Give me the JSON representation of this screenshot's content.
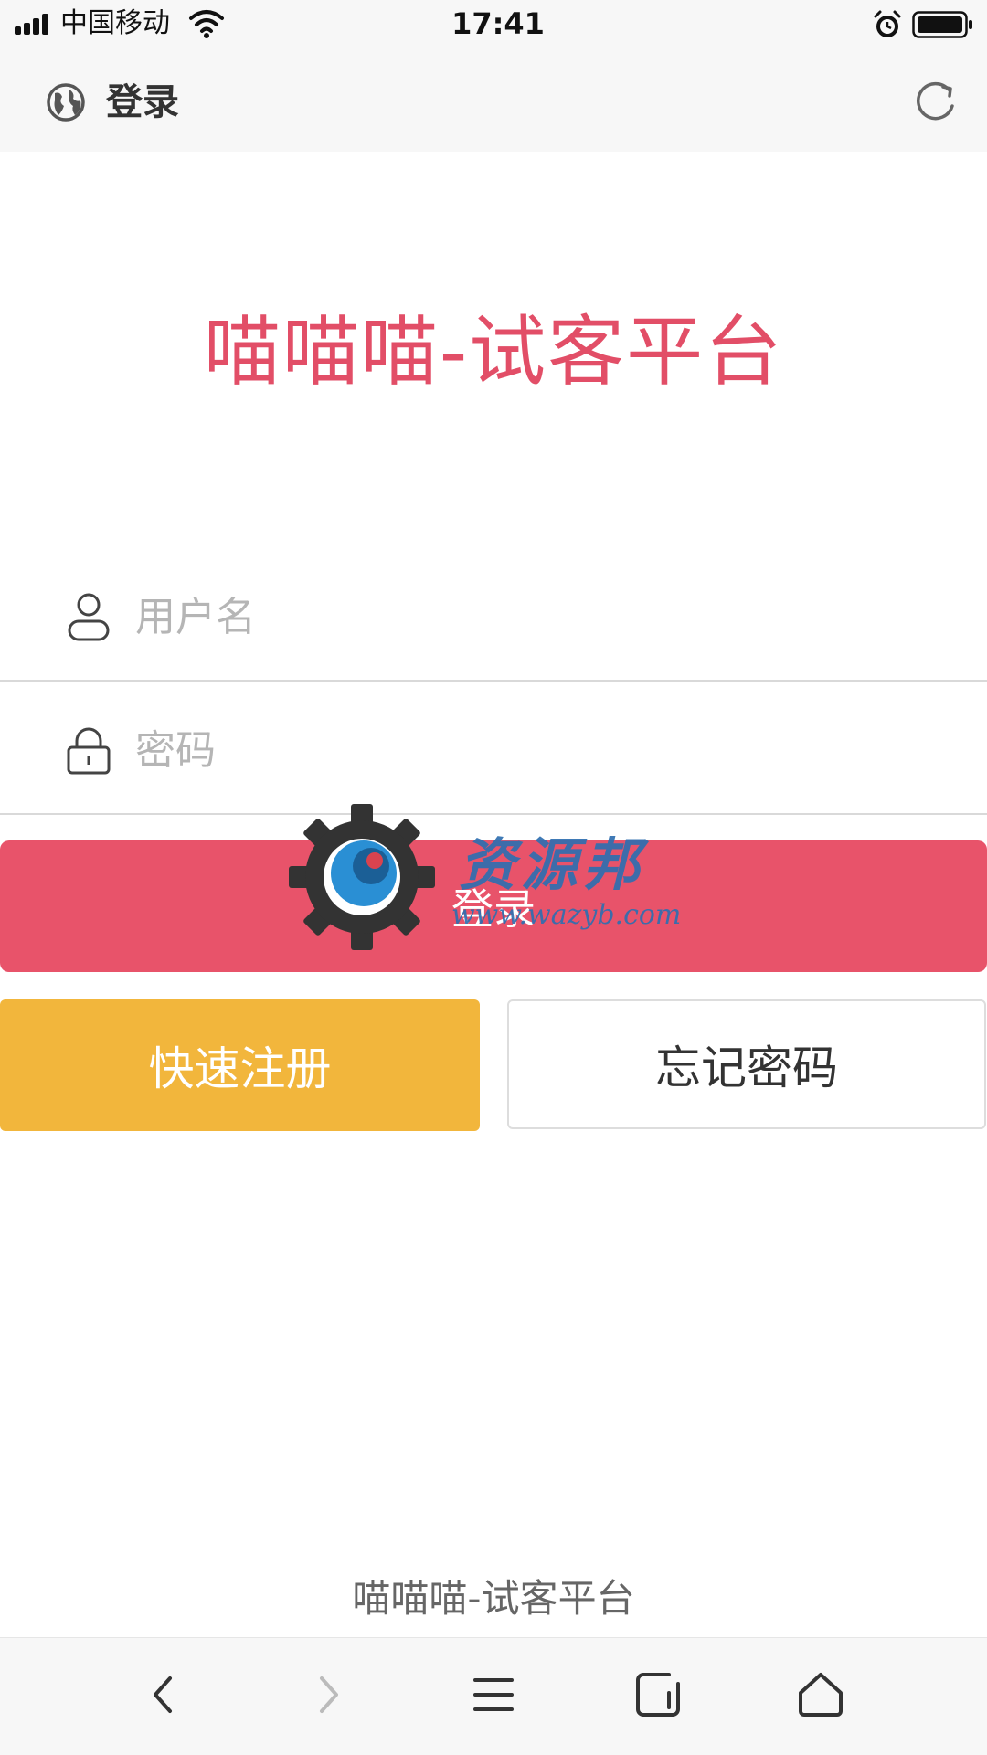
{
  "status_bar": {
    "carrier": "中国移动",
    "time": "17:41"
  },
  "nav_bar": {
    "title": "登录"
  },
  "main": {
    "title": "喵喵喵-试客平台"
  },
  "form": {
    "username_placeholder": "用户名",
    "password_placeholder": "密码",
    "login_label": "登录",
    "register_label": "快速注册",
    "forgot_label": "忘记密码"
  },
  "watermark": {
    "name": "资源邦",
    "url": "www.wazyb.com"
  },
  "footer": {
    "text": "喵喵喵-试客平台"
  },
  "colors": {
    "accent": "#e24e67",
    "login_button": "#e8536a",
    "register_button": "#f2b63c",
    "toolbar_bg": "#f7f7f7"
  },
  "icons": {
    "status": [
      "signal-icon",
      "wifi-icon",
      "alarm-icon",
      "battery-icon"
    ],
    "nav": [
      "globe-icon",
      "refresh-icon"
    ],
    "form": [
      "user-icon",
      "lock-icon"
    ],
    "toolbar": [
      "back-icon",
      "forward-icon",
      "menu-icon",
      "tabs-icon",
      "home-icon"
    ]
  }
}
